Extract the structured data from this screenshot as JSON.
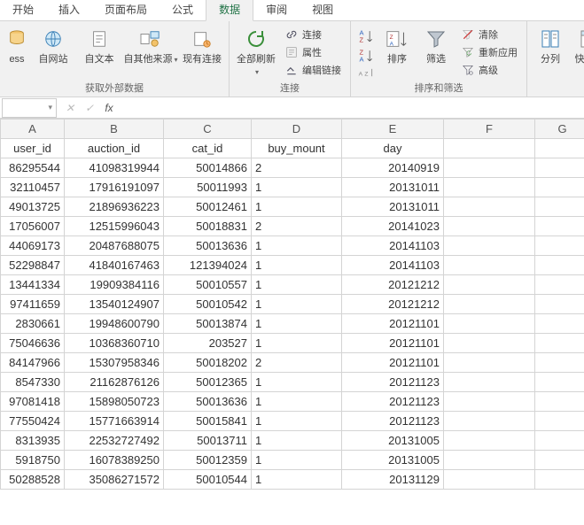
{
  "ribbon": {
    "tabs": [
      "开始",
      "插入",
      "页面布局",
      "公式",
      "数据",
      "审阅",
      "视图"
    ],
    "active_tab_index": 4,
    "groups": {
      "getdata": {
        "label": "获取外部数据",
        "btns": {
          "access": "ess",
          "web": "自网站",
          "text": "自文本",
          "other": "自其他来源",
          "conn": "现有连接"
        }
      },
      "conn": {
        "label": "连接",
        "btns": {
          "refresh": "全部刷新",
          "connections": "连接",
          "properties": "属性",
          "edit_links": "编辑链接"
        }
      },
      "sort": {
        "label": "排序和筛选",
        "btns": {
          "az": "A→Z",
          "za": "Z→A",
          "sort": "排序",
          "filter": "筛选",
          "clear": "清除",
          "reapply": "重新应用",
          "advanced": "高级"
        }
      },
      "tools": {
        "label": "",
        "btns": {
          "t2c": "分列",
          "flash": "快速填"
        }
      }
    }
  },
  "formula_bar": {
    "name_box": "",
    "formula": ""
  },
  "columns": [
    "A",
    "B",
    "C",
    "D",
    "E",
    "F",
    "G"
  ],
  "headers": [
    "user_id",
    "auction_id",
    "cat_id",
    "buy_mount",
    "day"
  ],
  "rows": [
    [
      "86295544",
      "41098319944",
      "50014866",
      "2",
      "20140919"
    ],
    [
      "32110457",
      "17916191097",
      "50011993",
      "1",
      "20131011"
    ],
    [
      "49013725",
      "21896936223",
      "50012461",
      "1",
      "20131011"
    ],
    [
      "17056007",
      "12515996043",
      "50018831",
      "2",
      "20141023"
    ],
    [
      "44069173",
      "20487688075",
      "50013636",
      "1",
      "20141103"
    ],
    [
      "52298847",
      "41840167463",
      "121394024",
      "1",
      "20141103"
    ],
    [
      "13441334",
      "19909384116",
      "50010557",
      "1",
      "20121212"
    ],
    [
      "97411659",
      "13540124907",
      "50010542",
      "1",
      "20121212"
    ],
    [
      "2830661",
      "19948600790",
      "50013874",
      "1",
      "20121101"
    ],
    [
      "75046636",
      "10368360710",
      "203527",
      "1",
      "20121101"
    ],
    [
      "84147966",
      "15307958346",
      "50018202",
      "2",
      "20121101"
    ],
    [
      "8547330",
      "21162876126",
      "50012365",
      "1",
      "20121123"
    ],
    [
      "97081418",
      "15898050723",
      "50013636",
      "1",
      "20121123"
    ],
    [
      "77550424",
      "15771663914",
      "50015841",
      "1",
      "20121123"
    ],
    [
      "8313935",
      "22532727492",
      "50013711",
      "1",
      "20131005"
    ],
    [
      "5918750",
      "16078389250",
      "50012359",
      "1",
      "20131005"
    ],
    [
      "50288528",
      "35086271572",
      "50010544",
      "1",
      "20131129"
    ]
  ]
}
